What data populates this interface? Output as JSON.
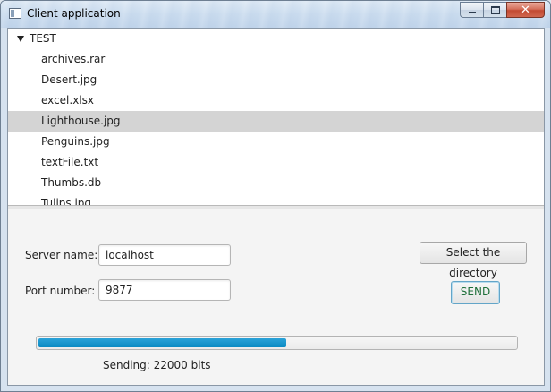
{
  "window": {
    "title": "Client application",
    "controls": {
      "minimize": "minimize",
      "maximize": "maximize",
      "close": "close"
    }
  },
  "tree": {
    "root_label": "TEST",
    "items": [
      {
        "label": "archives.rar",
        "selected": false
      },
      {
        "label": "Desert.jpg",
        "selected": false
      },
      {
        "label": "excel.xlsx",
        "selected": false
      },
      {
        "label": "Lighthouse.jpg",
        "selected": true
      },
      {
        "label": "Penguins.jpg",
        "selected": false
      },
      {
        "label": "textFile.txt",
        "selected": false
      },
      {
        "label": "Thumbs.db",
        "selected": false
      },
      {
        "label": "Tulips.jpg",
        "selected": false
      }
    ]
  },
  "form": {
    "server_label": "Server name:",
    "server_value": "localhost",
    "port_label": "Port number:",
    "port_value": "9877",
    "select_dir_label": "Select the directory",
    "send_label": "SEND"
  },
  "progress": {
    "fraction": 0.52,
    "status_text": "Sending: 22000 bits"
  },
  "colors": {
    "progress_fill": "#0a8ac3",
    "selection": "#d4d4d4",
    "send_text": "#1e6f3a"
  }
}
